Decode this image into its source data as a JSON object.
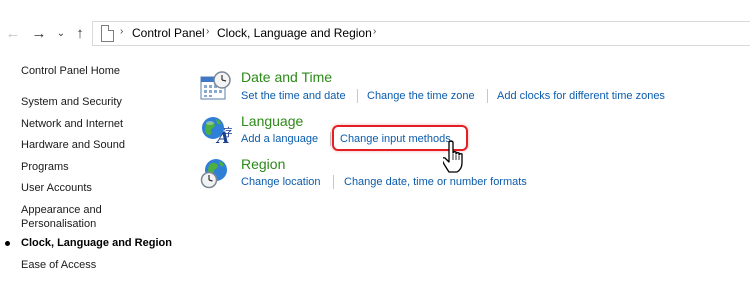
{
  "nav": {
    "back_icon": "back-arrow-icon",
    "forward_icon": "forward-arrow-icon",
    "recent_icon": "chevron-down-icon",
    "up_icon": "up-arrow-icon"
  },
  "breadcrumb": {
    "items": [
      "Control Panel",
      "Clock, Language and Region"
    ],
    "separator": "›"
  },
  "sidebar": {
    "home": "Control Panel Home",
    "items": [
      "System and Security",
      "Network and Internet",
      "Hardware and Sound",
      "Programs",
      "User Accounts",
      "Appearance and",
      "Personalisation",
      "Clock, Language and Region",
      "Ease of Access"
    ],
    "current": "Clock, Language and Region"
  },
  "categories": [
    {
      "title": "Date and Time",
      "icon": "calendar-clock-icon",
      "links": [
        "Set the time and date",
        "Change the time zone",
        "Add clocks for different time zones"
      ]
    },
    {
      "title": "Language",
      "icon": "globe-language-icon",
      "links": [
        "Add a language",
        "Change input methods"
      ]
    },
    {
      "title": "Region",
      "icon": "globe-clock-icon",
      "links": [
        "Change location",
        "Change date, time or number formats"
      ]
    }
  ],
  "colors": {
    "category_title": "#2c8a18",
    "link": "#0b5cad",
    "highlight": "#e11f25"
  },
  "annotation": {
    "highlighted_link": "Change input methods",
    "cursor_icon": "hand-pointer-icon"
  }
}
